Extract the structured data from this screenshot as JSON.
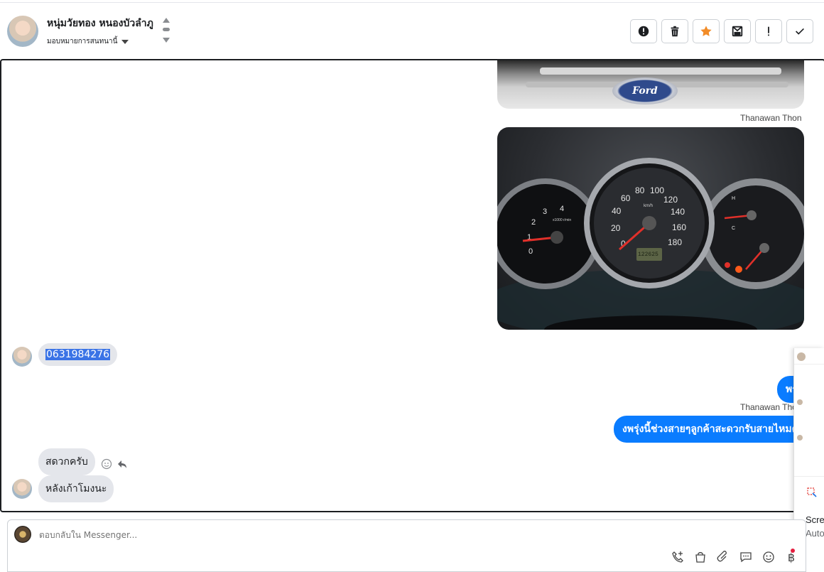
{
  "header": {
    "contact_name": "หนุ่มวัยทอง หนองบัวลำภู",
    "assign_label": "มอบหมายการสนทนานี้",
    "actions": [
      {
        "name": "report-spam-icon"
      },
      {
        "name": "trash-icon"
      },
      {
        "name": "star-icon"
      },
      {
        "name": "archive-icon"
      },
      {
        "name": "mark-important-icon"
      },
      {
        "name": "done-check-icon"
      }
    ]
  },
  "messages": {
    "img1_logo_text": "Ford",
    "sender_1": "Thanawan Thon",
    "gauge": {
      "rpm_ticks": [
        "0",
        "1",
        "2",
        "3",
        "4"
      ],
      "rpm_unit": "x1000 r/min",
      "speed_ticks": [
        "0",
        "20",
        "40",
        "60",
        "80",
        "100",
        "120",
        "140",
        "160",
        "180"
      ],
      "speed_unit": "km/h",
      "odometer": "122625",
      "fuel_labels": [
        "H",
        "C"
      ]
    },
    "phone": "0631984276",
    "out_partial": "พรุ่",
    "sender_2": "Thanawan Thon",
    "out_question": "งพรุ่งนี้ช่วงสายๆลูกค้าสะดวกรับสายไหมคะ",
    "in_1": "สดวกครับ",
    "in_2": "หลังเก้าโมงนะ"
  },
  "side_panel": {
    "title_line1": "Scre",
    "title_line2": "Auto"
  },
  "composer": {
    "placeholder": "ตอบกลับใน Messenger...",
    "tools": [
      "call-add-icon",
      "shopping-bag-icon",
      "attachment-icon",
      "saved-replies-icon",
      "emoji-icon",
      "baht-payment-icon"
    ],
    "baht_symbol": "฿"
  },
  "colors": {
    "outgoing": "#0a7cff",
    "incoming": "#e4e6eb",
    "star": "#f28c28"
  }
}
